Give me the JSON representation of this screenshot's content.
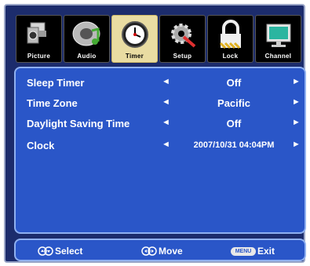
{
  "tabs": [
    {
      "label": "Picture",
      "icon": "camera-icon",
      "active": false
    },
    {
      "label": "Audio",
      "icon": "speaker-music-icon",
      "active": false
    },
    {
      "label": "Timer",
      "icon": "clock-icon",
      "active": true
    },
    {
      "label": "Setup",
      "icon": "gear-tools-icon",
      "active": false
    },
    {
      "label": "Lock",
      "icon": "padlock-icon",
      "active": false
    },
    {
      "label": "Channel",
      "icon": "monitor-icon",
      "active": false
    }
  ],
  "settings": [
    {
      "name": "Sleep Timer",
      "value": "Off"
    },
    {
      "name": "Time Zone",
      "value": "Pacific"
    },
    {
      "name": "Daylight Saving Time",
      "value": "Off"
    },
    {
      "name": "Clock",
      "value": "2007/10/31 04:04PM"
    }
  ],
  "arrows": {
    "left": "◄",
    "right": "►"
  },
  "footer": {
    "select": "Select",
    "move": "Move",
    "menu_key": "MENU",
    "exit": "Exit"
  },
  "colors": {
    "background": "#1c2c6c",
    "panel": "#2a56c8",
    "active_tab": "#e9dca2"
  }
}
